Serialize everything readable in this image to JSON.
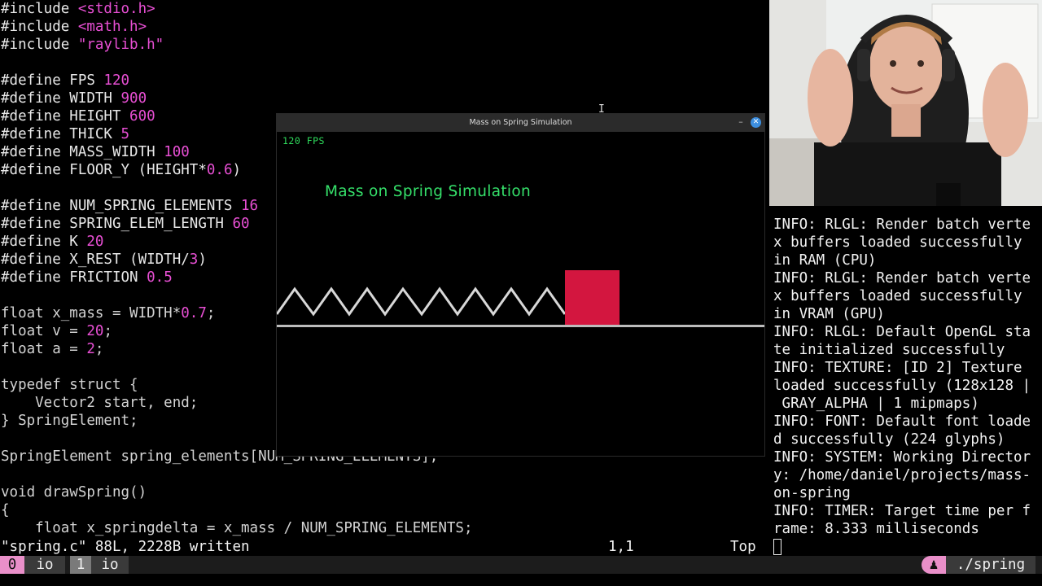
{
  "editor": {
    "lines": [
      [
        {
          "t": "#include ",
          "c": "pre"
        },
        {
          "t": "<stdio.h>",
          "c": "str"
        }
      ],
      [
        {
          "t": "#include ",
          "c": "pre"
        },
        {
          "t": "<math.h>",
          "c": "str"
        }
      ],
      [
        {
          "t": "#include ",
          "c": "pre"
        },
        {
          "t": "\"raylib.h\"",
          "c": "str"
        }
      ],
      [],
      [
        {
          "t": "#define FPS ",
          "c": "pre"
        },
        {
          "t": "120",
          "c": "num"
        }
      ],
      [
        {
          "t": "#define WIDTH ",
          "c": "pre"
        },
        {
          "t": "900",
          "c": "num"
        }
      ],
      [
        {
          "t": "#define HEIGHT ",
          "c": "pre"
        },
        {
          "t": "600",
          "c": "num"
        }
      ],
      [
        {
          "t": "#define THICK ",
          "c": "pre"
        },
        {
          "t": "5",
          "c": "num"
        }
      ],
      [
        {
          "t": "#define MASS_WIDTH ",
          "c": "pre"
        },
        {
          "t": "100",
          "c": "num"
        }
      ],
      [
        {
          "t": "#define FLOOR_Y (HEIGHT*",
          "c": "pre"
        },
        {
          "t": "0.6",
          "c": "num"
        },
        {
          "t": ")",
          "c": "pre"
        }
      ],
      [],
      [
        {
          "t": "#define NUM_SPRING_ELEMENTS ",
          "c": "pre"
        },
        {
          "t": "16",
          "c": "num"
        }
      ],
      [
        {
          "t": "#define SPRING_ELEM_LENGTH ",
          "c": "pre"
        },
        {
          "t": "60",
          "c": "num"
        }
      ],
      [
        {
          "t": "#define K ",
          "c": "pre"
        },
        {
          "t": "20",
          "c": "num"
        }
      ],
      [
        {
          "t": "#define X_REST (WIDTH/",
          "c": "pre"
        },
        {
          "t": "3",
          "c": "num"
        },
        {
          "t": ")",
          "c": "pre"
        }
      ],
      [
        {
          "t": "#define FRICTION ",
          "c": "pre"
        },
        {
          "t": "0.5",
          "c": "num"
        }
      ],
      [],
      [
        {
          "t": "float x_mass = WIDTH*",
          "c": "kw"
        },
        {
          "t": "0.7",
          "c": "num"
        },
        {
          "t": ";",
          "c": "kw"
        }
      ],
      [
        {
          "t": "float v = ",
          "c": "kw"
        },
        {
          "t": "20",
          "c": "num"
        },
        {
          "t": ";",
          "c": "kw"
        }
      ],
      [
        {
          "t": "float a = ",
          "c": "kw"
        },
        {
          "t": "2",
          "c": "num"
        },
        {
          "t": ";",
          "c": "kw"
        }
      ],
      [],
      [
        {
          "t": "typedef struct {",
          "c": "kw"
        }
      ],
      [
        {
          "t": "    Vector2 start, end;",
          "c": "kw"
        }
      ],
      [
        {
          "t": "} SpringElement;",
          "c": "kw"
        }
      ],
      [],
      [
        {
          "t": "SpringElement spring_elements[NUM_SPRING_ELEMENTS];",
          "c": "kw"
        }
      ],
      [],
      [
        {
          "t": "void drawSpring()",
          "c": "kw"
        }
      ],
      [
        {
          "t": "{",
          "c": "kw"
        }
      ],
      [
        {
          "t": "    float x_springdelta = x_mass / NUM_SPRING_ELEMENTS;",
          "c": "kw"
        }
      ]
    ],
    "status_left": "\"spring.c\" 88L, 2228B written",
    "status_pos": "1,1",
    "status_scroll": "Top"
  },
  "simulation": {
    "window_title": "Mass on Spring Simulation",
    "fps_label": "120 FPS",
    "heading": "Mass on Spring Simulation",
    "spring_color": "#d8d8d8",
    "mass_color": "#d3163f",
    "text_color": "#35e06a"
  },
  "terminal": {
    "lines": [
      "INFO: RLGL: Render batch verte",
      "x buffers loaded successfully",
      "in RAM (CPU)",
      "INFO: RLGL: Render batch verte",
      "x buffers loaded successfully",
      "in VRAM (GPU)",
      "INFO: RLGL: Default OpenGL sta",
      "te initialized successfully",
      "INFO: TEXTURE: [ID 2] Texture",
      "loaded successfully (128x128 |",
      " GRAY_ALPHA | 1 mipmaps)",
      "INFO: FONT: Default font loade",
      "d successfully (224 glyphs)",
      "INFO: SYSTEM: Working Director",
      "y: /home/daniel/projects/mass-",
      "on-spring",
      "INFO: TIMER: Target time per f",
      "rame: 8.333 milliseconds"
    ]
  },
  "tmux": {
    "win0_index": "0",
    "win0_name": "io",
    "win1_index": "1",
    "win1_name": "io",
    "right_label": "./spring",
    "accent": "#e98fc9"
  }
}
